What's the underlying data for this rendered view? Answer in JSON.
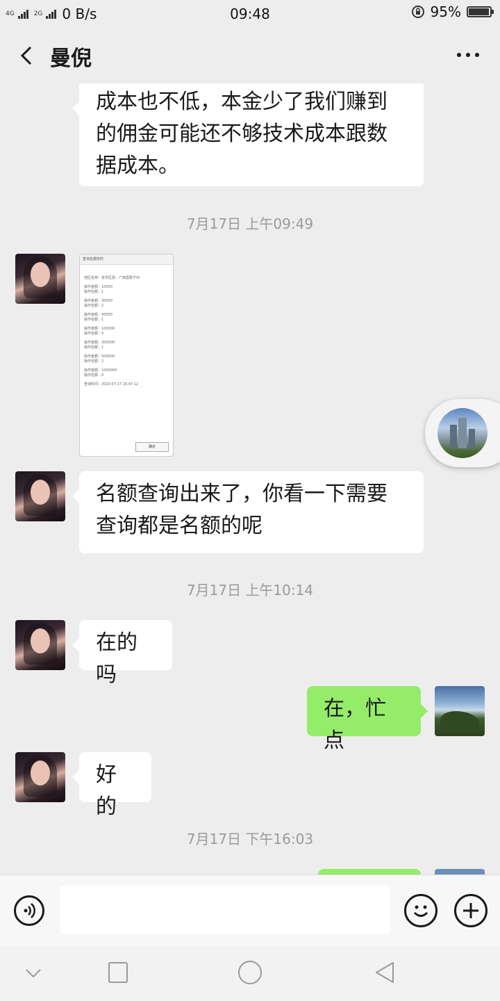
{
  "status_bar": {
    "network_1": "4G",
    "network_2": "2G",
    "net_speed": "0 B/s",
    "time": "09:48",
    "battery": "95%",
    "battery_level": 0.95
  },
  "header": {
    "contact_name": "曼倪",
    "back_icon": "chevron-left-icon",
    "more_icon": "more-dots-icon"
  },
  "messages": {
    "m0": "成本也不低，本金少了我们赚到的佣金可能还不够技术成本跟数据成本。",
    "t1": "7月17日 上午09:49",
    "shot": {
      "title": "查询名额实时",
      "lines": [
        "地区名称：省市区县：广西壹联干州",
        "",
        "操作金额：10000",
        "操作名额：1",
        "",
        "操作金额：30000",
        "操作名额：2",
        "",
        "操作金额：50000",
        "操作名额：1",
        "",
        "操作金额：100000",
        "操作名额：0",
        "",
        "操作金额：300000",
        "操作名额：1",
        "",
        "操作金额：500000",
        "操作名额：2",
        "",
        "操作金额：1000000",
        "操作名额：0",
        "",
        "查询时间：2020-07-17 16:47:12"
      ],
      "button": "确定"
    },
    "m2": "名额查询出来了，你看一下需要查询都是名额的呢",
    "t2": "7月17日 上午10:14",
    "m3": "在的吗",
    "m4": "在，忙点",
    "m5": "好的",
    "t3": "7月17日 下午16:03"
  },
  "input_bar": {
    "voice_icon": "voice-icon",
    "emoji_icon": "emoji-icon",
    "plus_icon": "plus-icon"
  },
  "colors": {
    "chat_bg": "#ededed",
    "my_bubble": "#95ec69",
    "their_bubble": "#ffffff",
    "timestamp": "#9a9a9a"
  }
}
